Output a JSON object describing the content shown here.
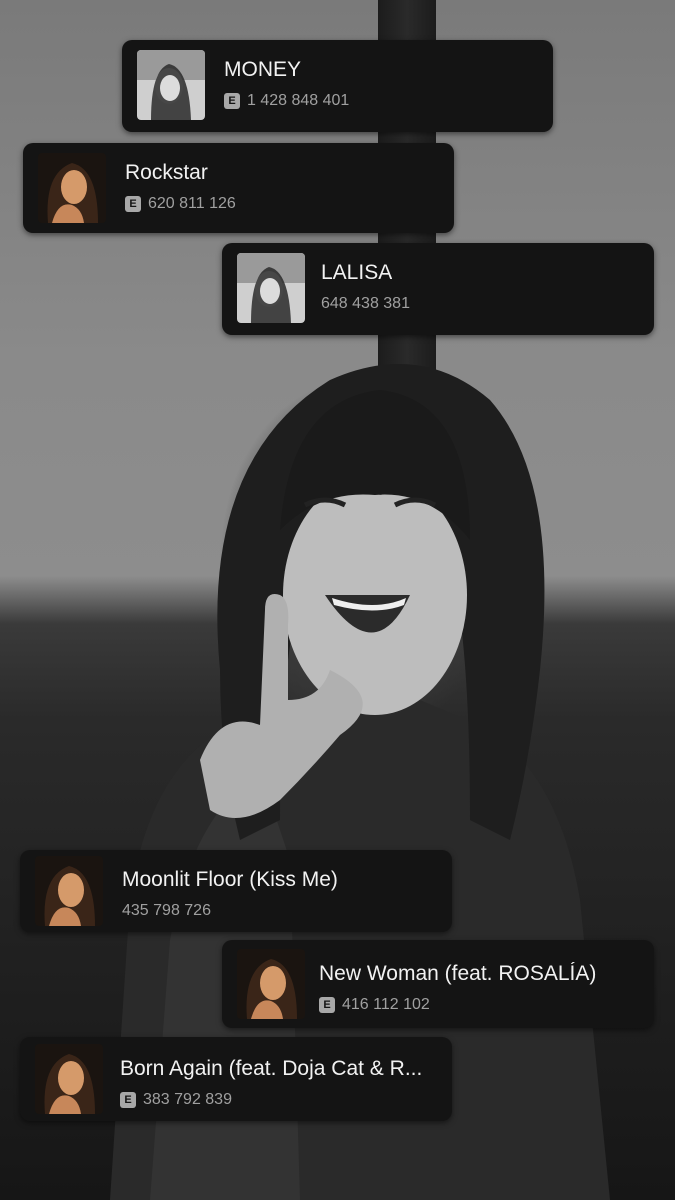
{
  "tracks": [
    {
      "title": "MONEY",
      "explicit": true,
      "explicit_label": "E",
      "plays": "1 428 848 401",
      "art": "bw-portrait-icon"
    },
    {
      "title": "Rockstar",
      "explicit": true,
      "explicit_label": "E",
      "plays": "620 811 126",
      "art": "color-portrait-icon"
    },
    {
      "title": "LALISA",
      "explicit": false,
      "plays": "648 438 381",
      "art": "bw-portrait-icon"
    },
    {
      "title": "Moonlit Floor (Kiss Me)",
      "explicit": false,
      "plays": "435 798 726",
      "art": "color-portrait-icon"
    },
    {
      "title": "New Woman (feat. ROSALÍA)",
      "explicit": true,
      "explicit_label": "E",
      "plays": "416 112 102",
      "art": "color-portrait-icon"
    },
    {
      "title": "Born Again (feat. Doja Cat & R...",
      "explicit": true,
      "explicit_label": "E",
      "plays": "383 792 839",
      "art": "color-portrait-icon"
    }
  ],
  "colors": {
    "card_bg": "#141414",
    "title": "#f2f2f2",
    "meta": "#a0a0a0"
  }
}
